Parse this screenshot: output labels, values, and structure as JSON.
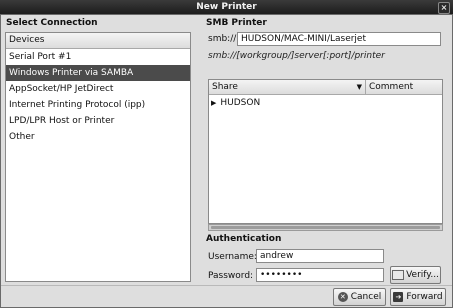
{
  "window": {
    "title": "New Printer",
    "close_glyph": "×"
  },
  "left": {
    "section_title": "Select Connection",
    "list_header": "Devices",
    "items": [
      {
        "label": "Serial Port #1",
        "selected": false
      },
      {
        "label": "Windows Printer via SAMBA",
        "selected": true
      },
      {
        "label": "AppSocket/HP JetDirect",
        "selected": false
      },
      {
        "label": "Internet Printing Protocol (ipp)",
        "selected": false
      },
      {
        "label": "LPD/LPR Host or Printer",
        "selected": false
      },
      {
        "label": "Other",
        "selected": false
      }
    ]
  },
  "smb": {
    "section_title": "SMB Printer",
    "prefix_label": "smb://",
    "path_value": "HUDSON/MAC-MINI/Laserjet",
    "hint": "smb://[workgroup/]server[:port]/printer",
    "table": {
      "columns": [
        "Share",
        "Comment"
      ],
      "sort_icon": "chevron-down-icon",
      "rows": [
        {
          "expander_icon": "triangle-right-icon",
          "label": "HUDSON"
        }
      ]
    }
  },
  "auth": {
    "section_title": "Authentication",
    "username_label": "Username:",
    "username_value": "andrew",
    "password_label": "Password:",
    "password_value": "••••••••",
    "verify_label": "Verify..."
  },
  "footer": {
    "cancel_label": "Cancel",
    "cancel_icon": "cancel-icon",
    "forward_label": "Forward",
    "forward_icon": "forward-arrow-icon"
  }
}
